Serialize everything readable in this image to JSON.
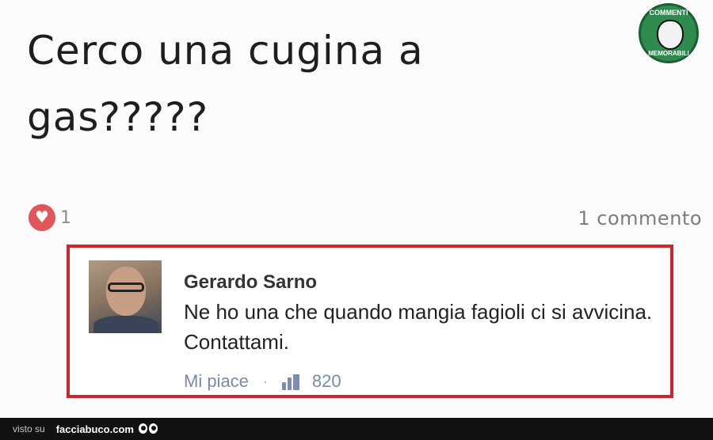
{
  "post": {
    "text_line1": "Cerco una cugina a",
    "text_line2": "gas?????",
    "reaction_count": "1",
    "comments_count": "1 commento",
    "logo": {
      "name": "commenti-memorabili-logo",
      "text_top": "COMMENTI",
      "text_bottom": "MEMORABILI"
    }
  },
  "comment": {
    "author": "Gerardo Sarno",
    "text": "Ne ho una che quando mangia fagioli ci si avvicina. Contattami.",
    "like_label": "Mi piace",
    "separator": "·",
    "like_count": "820"
  },
  "footer": {
    "visto_su": "visto su",
    "site": "facciabuco.com"
  },
  "colors": {
    "highlight_border": "#c8282e",
    "heart": "#e0565b",
    "link_gray_blue": "#7a8aa6",
    "logo_green": "#2e8b4e"
  },
  "icons": [
    "heart-icon",
    "thumbs-up-icon",
    "eyes-icon",
    "logo-face-icon"
  ]
}
